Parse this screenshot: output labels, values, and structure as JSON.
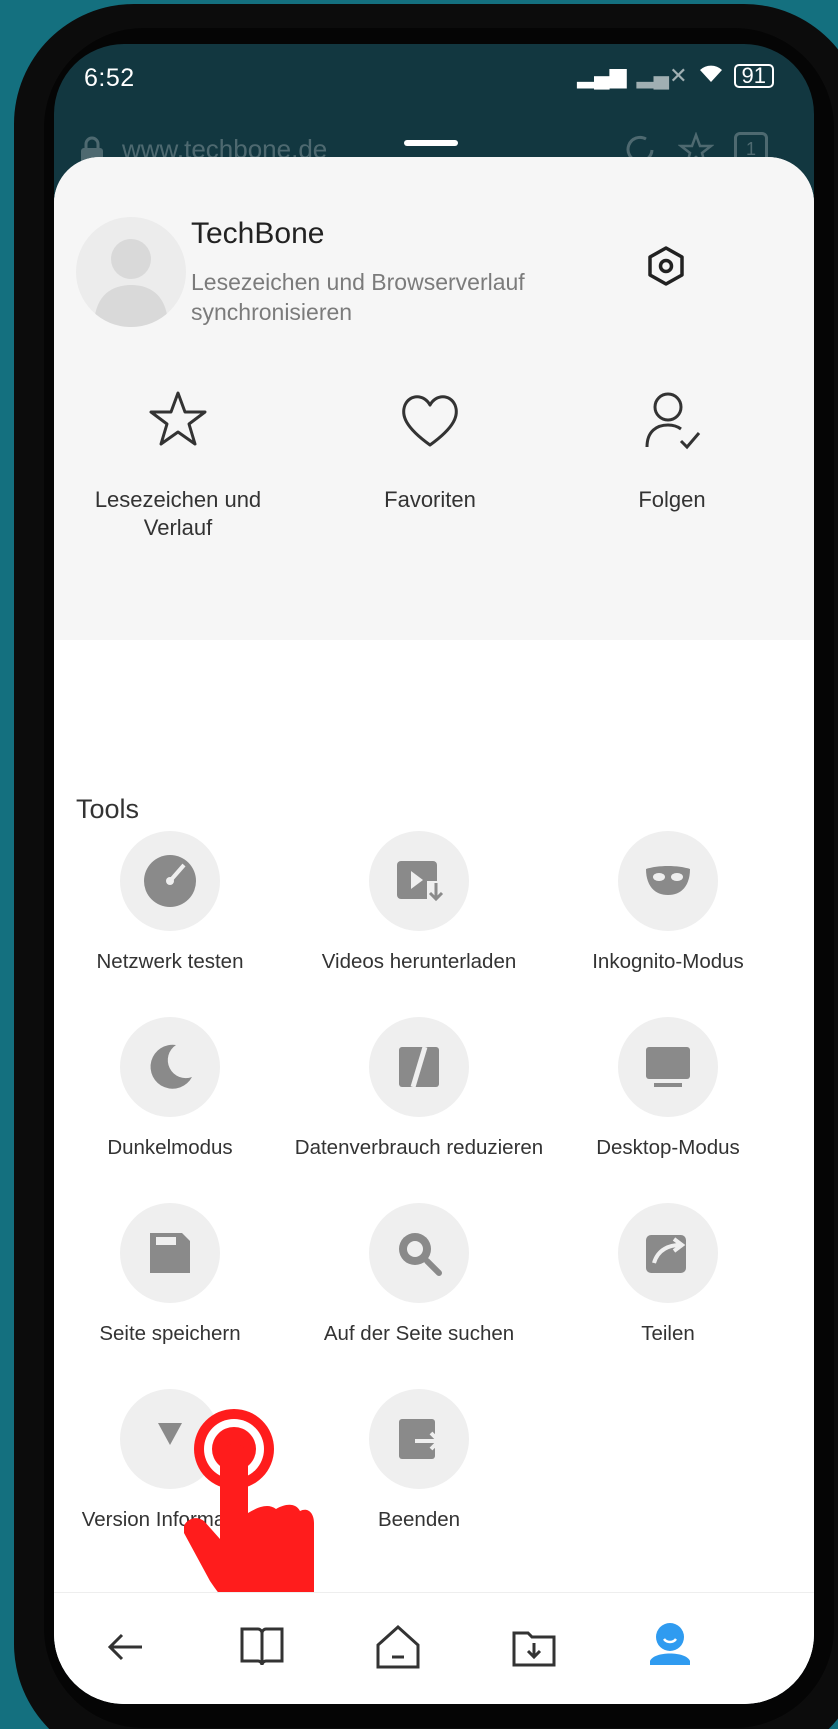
{
  "status_bar": {
    "time": "6:52",
    "battery": "91"
  },
  "browser": {
    "url": "www.techbone.de",
    "tab_count": "1"
  },
  "profile": {
    "name": "TechBone",
    "subtitle": "Lesezeichen und Browserverlauf synchronisieren"
  },
  "quick_actions": [
    {
      "label": "Lesezeichen und\nVerlauf",
      "icon": "star-icon"
    },
    {
      "label": "Favoriten",
      "icon": "heart-icon"
    },
    {
      "label": "Folgen",
      "icon": "user-check-icon"
    }
  ],
  "tools": {
    "title": "Tools",
    "items": [
      {
        "label": "Netzwerk testen",
        "icon": "speedometer-icon"
      },
      {
        "label": "Videos herunterladen",
        "icon": "video-download-icon"
      },
      {
        "label": "Inkognito-Modus",
        "icon": "mask-icon"
      },
      {
        "label": "Dunkelmodus",
        "icon": "moon-icon"
      },
      {
        "label": "Datenverbrauch reduzieren",
        "icon": "data-saver-icon"
      },
      {
        "label": "Desktop-Modus",
        "icon": "monitor-icon"
      },
      {
        "label": "Seite speichern",
        "icon": "save-icon"
      },
      {
        "label": "Auf der Seite suchen",
        "icon": "search-icon"
      },
      {
        "label": "Teilen",
        "icon": "share-icon"
      },
      {
        "label": "Version Information",
        "icon": "info-icon"
      },
      {
        "label": "Beenden",
        "icon": "exit-icon"
      }
    ]
  },
  "bottom_nav": [
    "back-arrow-icon",
    "book-icon",
    "home-icon",
    "downloads-folder-icon",
    "profile-icon"
  ],
  "colors": {
    "background": "#14707f",
    "accent_blue": "#2f9bf0",
    "touch_red": "#ff1c1c"
  }
}
